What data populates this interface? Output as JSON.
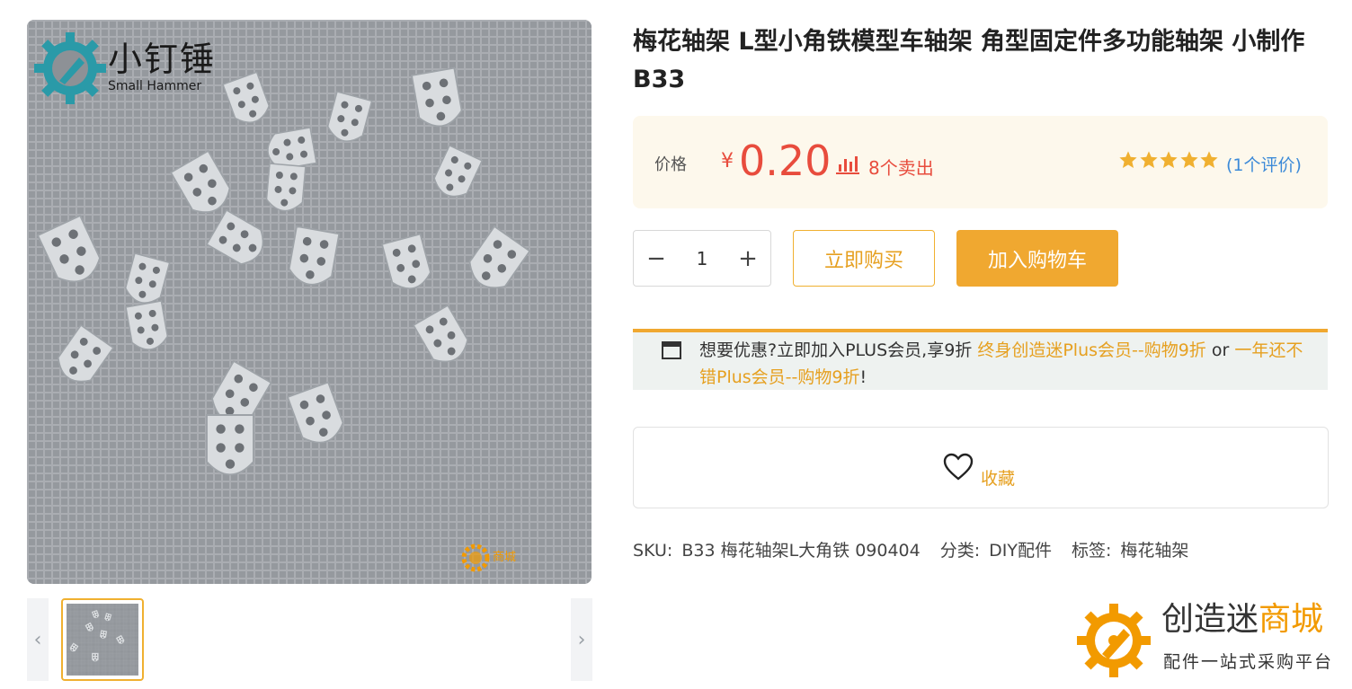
{
  "image": {
    "brand_cn": "小钉锤",
    "brand_en": "Small Hammer",
    "watermark_shop": "商城"
  },
  "thumbs": {
    "prev": "‹",
    "next": "›"
  },
  "product": {
    "title": "梅花轴架 L型小角铁模型车轴架 角型固定件多功能轴架 小制作B33",
    "price_label": "价格",
    "currency": "¥",
    "price": "0.20",
    "sold": "8个卖出",
    "rating_stars": 5,
    "reviews": "(1个评价)"
  },
  "purchase": {
    "qty": "1",
    "minus": "−",
    "plus": "+",
    "buy_now": "立即购买",
    "add_cart": "加入购物车"
  },
  "promo": {
    "text1": "想要优惠?立即加入PLUS会员,享9折 ",
    "link1": "终身创造迷Plus会员--购物9折",
    "or": " or ",
    "link2": "一年还不错Plus会员--购物9折",
    "end": "!"
  },
  "favorite": {
    "label": "收藏"
  },
  "meta": {
    "sku_label": "SKU:",
    "sku_value": "B33 梅花轴架L大角铁 090404",
    "category_label": "分类:",
    "category_value": "DIY配件",
    "tag_label": "标签:",
    "tag_value": "梅花轴架"
  },
  "site": {
    "name_main": "创造迷",
    "name_accent": "商城",
    "slogan": "配件一站式采购平台"
  },
  "colors": {
    "accent": "#f0a830",
    "price": "#e84c3d",
    "link": "#3c8ad8",
    "gear_teal": "#2a9aa8",
    "gear_orange": "#f29a00"
  }
}
